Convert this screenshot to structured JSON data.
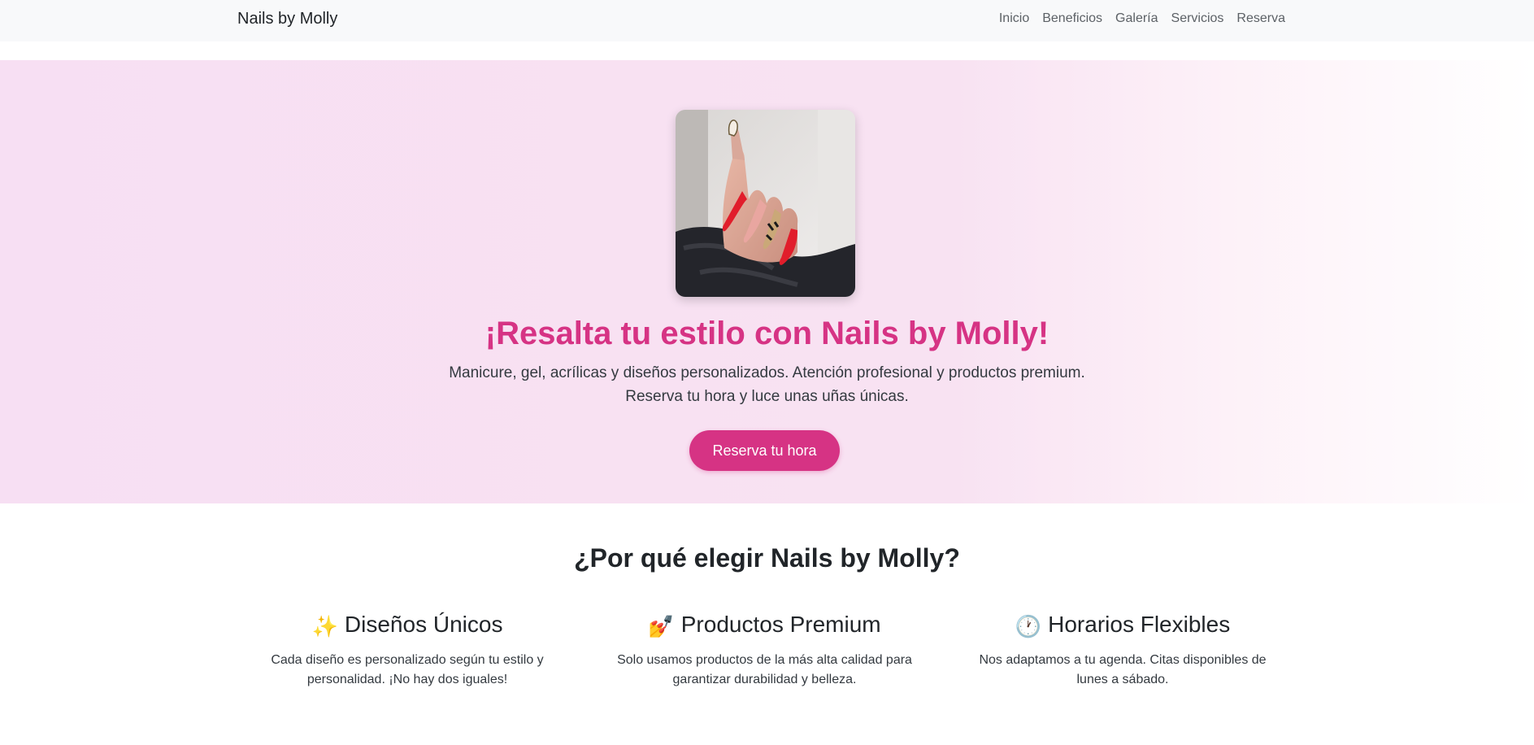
{
  "navbar": {
    "brand": "Nails by Molly",
    "links": [
      "Inicio",
      "Beneficios",
      "Galería",
      "Servicios",
      "Reserva"
    ]
  },
  "hero": {
    "image_alt": "hand-with-red-nails-photo",
    "title": "¡Resalta tu estilo con Nails by Molly!",
    "subtitle_line1": "Manicure, gel, acrílicas y diseños personalizados. Atención profesional y productos premium.",
    "subtitle_line2": "Reserva tu hora y luce unas uñas únicas.",
    "cta_label": "Reserva tu hora"
  },
  "why": {
    "title": "¿Por qué elegir Nails by Molly?",
    "features": [
      {
        "emoji": "✨",
        "icon": "sparkles-icon",
        "title": "Diseños Únicos",
        "desc_line1": "Cada diseño es personalizado según tu estilo y",
        "desc_line2": "personalidad. ¡No hay dos iguales!"
      },
      {
        "emoji": "💅",
        "icon": "nail-polish-icon",
        "title": "Productos Premium",
        "desc_line1": "Solo usamos productos de la más alta calidad para",
        "desc_line2": "garantizar durabilidad y belleza."
      },
      {
        "emoji": "🕐",
        "icon": "clock-icon",
        "title": "Horarios Flexibles",
        "desc_line1": "Nos adaptamos a tu agenda. Citas disponibles de",
        "desc_line2": "lunes a sábado."
      }
    ]
  },
  "colors": {
    "accent": "#d63384",
    "navbar_bg": "#f8f9fa",
    "hero_bg": "#f7dff3"
  }
}
